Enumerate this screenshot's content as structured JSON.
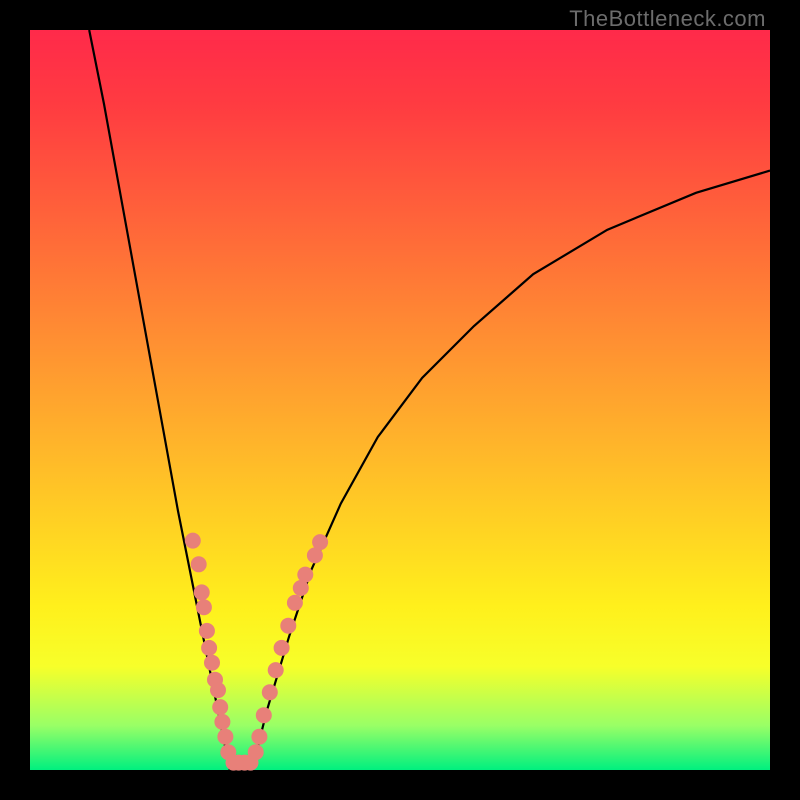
{
  "watermark": "TheBottleneck.com",
  "colors": {
    "frame": "#000000",
    "gradient_stops": [
      "#ff2a4a",
      "#ff3b41",
      "#ff623a",
      "#ff8a33",
      "#ffb22b",
      "#ffd223",
      "#fff01c",
      "#f7ff2a",
      "#99ff66",
      "#00f07f"
    ],
    "curve": "#000000",
    "dots": "#e88079"
  },
  "chart_data": {
    "type": "line",
    "title": "",
    "xlabel": "",
    "ylabel": "",
    "xlim": [
      0,
      100
    ],
    "ylim": [
      0,
      100
    ],
    "grid": false,
    "legend": false,
    "series": [
      {
        "name": "left-curve",
        "x": [
          8,
          10,
          12,
          14,
          16,
          18,
          20,
          22,
          24,
          26,
          27
        ],
        "y": [
          100,
          90,
          79,
          68,
          57,
          46,
          35,
          25,
          15,
          5,
          0
        ]
      },
      {
        "name": "right-curve",
        "x": [
          30,
          32,
          35,
          38,
          42,
          47,
          53,
          60,
          68,
          78,
          90,
          100
        ],
        "y": [
          0,
          8,
          18,
          27,
          36,
          45,
          53,
          60,
          67,
          73,
          78,
          81
        ]
      }
    ],
    "scatter_overlay": {
      "name": "dots",
      "points": [
        {
          "x": 22.0,
          "y": 31.0,
          "kind": "left"
        },
        {
          "x": 22.8,
          "y": 27.8,
          "kind": "left"
        },
        {
          "x": 23.2,
          "y": 24.0,
          "kind": "left"
        },
        {
          "x": 23.5,
          "y": 22.0,
          "kind": "left"
        },
        {
          "x": 23.9,
          "y": 18.8,
          "kind": "left"
        },
        {
          "x": 24.2,
          "y": 16.5,
          "kind": "left"
        },
        {
          "x": 24.6,
          "y": 14.5,
          "kind": "left"
        },
        {
          "x": 25.0,
          "y": 12.2,
          "kind": "left"
        },
        {
          "x": 25.4,
          "y": 10.8,
          "kind": "left"
        },
        {
          "x": 25.7,
          "y": 8.5,
          "kind": "left"
        },
        {
          "x": 26.0,
          "y": 6.5,
          "kind": "left"
        },
        {
          "x": 26.4,
          "y": 4.5,
          "kind": "left"
        },
        {
          "x": 26.8,
          "y": 2.4,
          "kind": "left"
        },
        {
          "x": 27.5,
          "y": 1.0,
          "kind": "bottom"
        },
        {
          "x": 28.2,
          "y": 1.0,
          "kind": "bottom"
        },
        {
          "x": 29.0,
          "y": 1.0,
          "kind": "bottom"
        },
        {
          "x": 29.8,
          "y": 1.0,
          "kind": "bottom"
        },
        {
          "x": 30.5,
          "y": 2.4,
          "kind": "right"
        },
        {
          "x": 31.0,
          "y": 4.5,
          "kind": "right"
        },
        {
          "x": 31.6,
          "y": 7.4,
          "kind": "right"
        },
        {
          "x": 32.4,
          "y": 10.5,
          "kind": "right"
        },
        {
          "x": 33.2,
          "y": 13.5,
          "kind": "right"
        },
        {
          "x": 34.0,
          "y": 16.5,
          "kind": "right"
        },
        {
          "x": 34.9,
          "y": 19.5,
          "kind": "right"
        },
        {
          "x": 35.8,
          "y": 22.6,
          "kind": "right"
        },
        {
          "x": 36.6,
          "y": 24.6,
          "kind": "right"
        },
        {
          "x": 37.2,
          "y": 26.4,
          "kind": "right"
        },
        {
          "x": 38.5,
          "y": 29.0,
          "kind": "right"
        },
        {
          "x": 39.2,
          "y": 30.8,
          "kind": "right"
        }
      ]
    }
  }
}
